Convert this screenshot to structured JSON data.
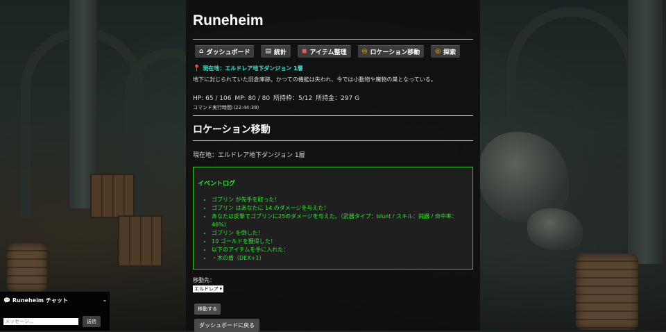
{
  "app": {
    "title": "Runeheim"
  },
  "nav": [
    {
      "icon": "house-icon",
      "label": "ダッシュボード"
    },
    {
      "icon": "scroll-icon",
      "label": "統計"
    },
    {
      "icon": "backpack-icon",
      "label": "アイテム整理"
    },
    {
      "icon": "compass-icon",
      "label": "ロケーション移動"
    },
    {
      "icon": "compass-icon",
      "label": "探索"
    }
  ],
  "location": {
    "current_label": "現在地：エルドレア地下ダンジョン 1層",
    "description": "地下に封じられていた旧倉庫跡。かつての機能は失われ、今では小動物や魔物の巣となっている。"
  },
  "status": {
    "hp": "HP: 65 / 106",
    "mp": "MP: 80 / 80",
    "slots": "所持枠：5/12",
    "gold": "所持金：297 G",
    "command_time": "コマンド実行時間:(22:44:39)"
  },
  "main": {
    "section_title": "ロケーション移動",
    "current_location": "現在地：エルドレア地下ダンジョン 1層"
  },
  "event_log": {
    "title": "イベントログ",
    "entries": [
      "ゴブリン が先手を取った！",
      "ゴブリン はあなたに 14 のダメージを与えた！",
      "あなたは反撃でゴブリンに25のダメージを与えた。（武器タイプ：blunt / スキル：鈍器 / 命中率：46%）",
      "ゴブリン を倒した！",
      "10 ゴールドを獲得した！",
      "以下のアイテムを手に入れた：",
      "・木の盾（DEX+1）"
    ]
  },
  "move": {
    "label": "移動先：",
    "selected": "エルドレア",
    "move_button": "移動する",
    "back_button": "ダッシュボードに戻る"
  },
  "chat": {
    "title": "Runeheim チャット",
    "minimize": "–",
    "placeholder": "メッセージ...",
    "send": "送信"
  }
}
